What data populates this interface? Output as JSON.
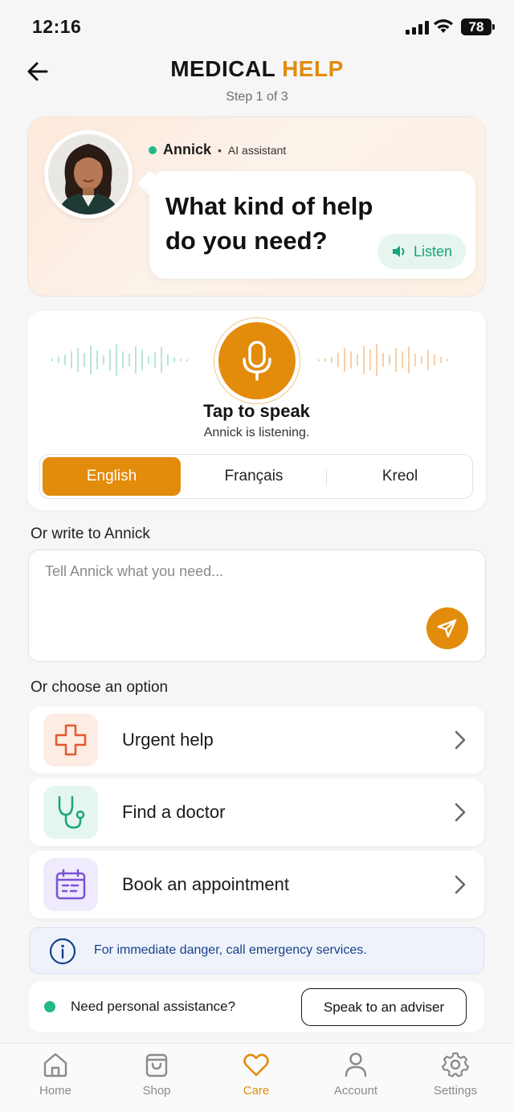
{
  "status": {
    "time": "12:16",
    "battery": "78"
  },
  "header": {
    "title_part1": "MEDICAL",
    "title_part2": "HELP",
    "step": "Step 1 of 3"
  },
  "assistant": {
    "name": "Annick",
    "role": "AI assistant",
    "question": "What kind of help do you need?",
    "listen_label": "Listen"
  },
  "voice": {
    "tap_label": "Tap to speak",
    "listening_label": "Annick is listening.",
    "languages": [
      "English",
      "Français",
      "Kreol"
    ],
    "selected_language": "English"
  },
  "write": {
    "section_label": "Or write to Annick",
    "placeholder": "Tell Annick what you need..."
  },
  "options": {
    "section_label": "Or choose an option",
    "items": [
      {
        "label": "Urgent help",
        "icon": "medical-cross-icon"
      },
      {
        "label": "Find a doctor",
        "icon": "stethoscope-icon"
      },
      {
        "label": "Book an appointment",
        "icon": "calendar-icon"
      }
    ]
  },
  "info": {
    "text": "For immediate danger, call emergency services."
  },
  "assist": {
    "text": "Need personal assistance?",
    "button": "Speak to an adviser"
  },
  "nav": {
    "items": [
      {
        "label": "Home",
        "icon": "home-icon"
      },
      {
        "label": "Shop",
        "icon": "shopping-bag-icon"
      },
      {
        "label": "Care",
        "icon": "heart-icon"
      },
      {
        "label": "Account",
        "icon": "person-icon"
      },
      {
        "label": "Settings",
        "icon": "gear-icon"
      }
    ],
    "active": "Care"
  },
  "colors": {
    "accent": "#e38b0b",
    "green": "#1fb98a",
    "info_text": "#1b3f8b"
  }
}
